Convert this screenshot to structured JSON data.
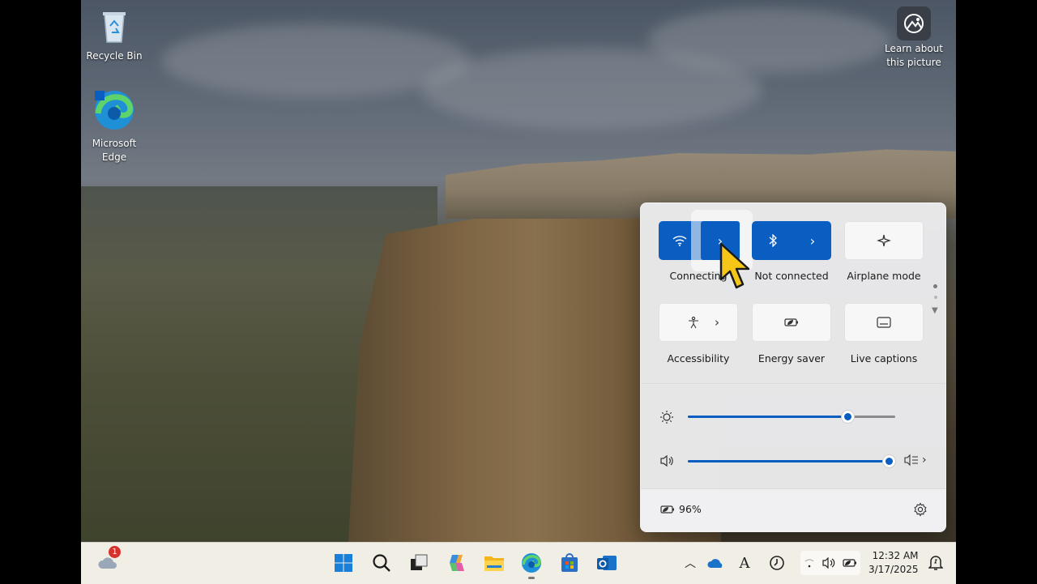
{
  "desktop": {
    "icons": [
      {
        "label": "Recycle Bin"
      },
      {
        "label": "Microsoft Edge"
      },
      {
        "label": "Learn about this picture"
      }
    ]
  },
  "quick_settings": {
    "tiles": [
      {
        "id": "wifi",
        "label": "Connecting",
        "state": "on",
        "icon": "wifi-icon",
        "has_chevron": true
      },
      {
        "id": "bluetooth",
        "label": "Not connected",
        "state": "on",
        "icon": "bluetooth-icon",
        "has_chevron": true
      },
      {
        "id": "airplane",
        "label": "Airplane mode",
        "state": "off",
        "icon": "airplane-icon"
      },
      {
        "id": "accessibility",
        "label": "Accessibility",
        "state": "off",
        "icon": "accessibility-icon",
        "has_chevron": true
      },
      {
        "id": "energy",
        "label": "Energy saver",
        "state": "off",
        "icon": "energy-saver-icon"
      },
      {
        "id": "captions",
        "label": "Live captions",
        "state": "off",
        "icon": "live-captions-icon"
      }
    ],
    "brightness": {
      "value": 0.77
    },
    "volume": {
      "value": 0.97
    },
    "battery": {
      "percent_label": "96%"
    }
  },
  "taskbar": {
    "clock": {
      "time": "12:32 AM",
      "date": "3/17/2025"
    },
    "weather_badge": "1",
    "pinned": [
      "start-icon",
      "search-icon",
      "task-view-icon",
      "copilot-icon",
      "file-explorer-icon",
      "edge-icon",
      "store-icon",
      "outlook-icon"
    ]
  },
  "colors": {
    "accent": "#0a5ec2",
    "cursor_highlight": "#ffffff",
    "cursor": "#f5c518"
  }
}
